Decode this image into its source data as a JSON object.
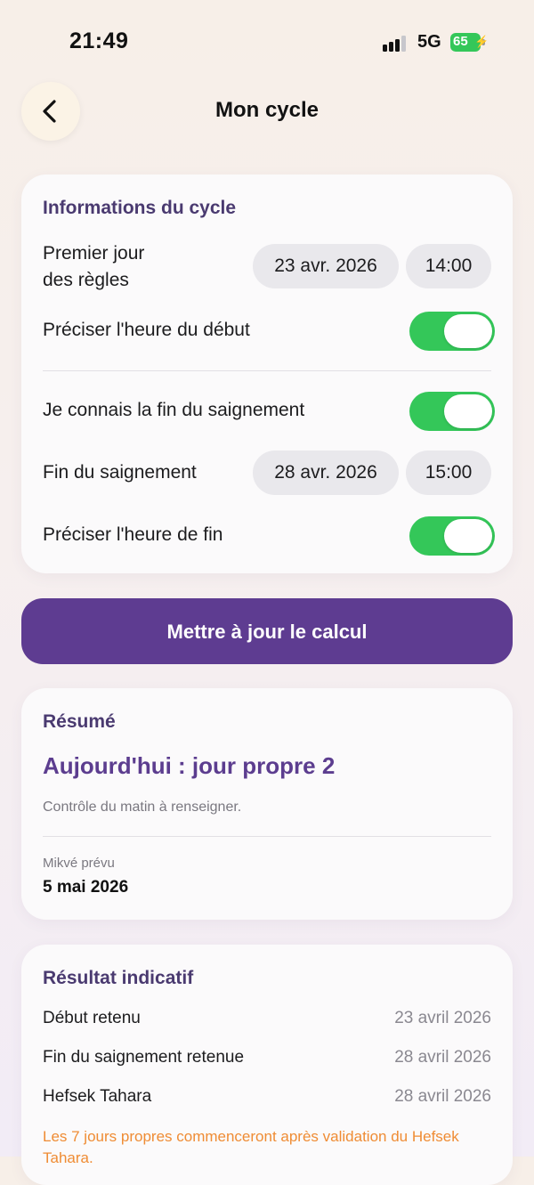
{
  "status_bar": {
    "time": "21:49",
    "network": "5G",
    "battery": "65"
  },
  "header": {
    "title": "Mon cycle"
  },
  "cycle_info": {
    "title": "Informations du cycle",
    "first_day_label_line1": "Premier jour",
    "first_day_label_line2": "des règles",
    "first_day_date": "23 avr. 2026",
    "first_day_time": "14:00",
    "start_time_toggle_label": "Préciser l'heure du début",
    "start_time_toggle_on": true,
    "know_end_label": "Je connais la fin du saignement",
    "know_end_on": true,
    "end_label": "Fin du saignement",
    "end_date": "28 avr. 2026",
    "end_time": "15:00",
    "end_time_toggle_label": "Préciser l'heure de fin",
    "end_time_toggle_on": true
  },
  "update_button": {
    "label": "Mettre à jour le calcul"
  },
  "summary": {
    "title": "Résumé",
    "status": "Aujourd'hui : jour propre 2",
    "note": "Contrôle du matin à renseigner.",
    "mikve_label": "Mikvé prévu",
    "mikve_date": "5 mai 2026"
  },
  "result": {
    "title": "Résultat indicatif",
    "rows": [
      {
        "label": "Début retenu",
        "value": "23 avril 2026"
      },
      {
        "label": "Fin du saignement retenue",
        "value": "28 avril 2026"
      },
      {
        "label": "Hefsek Tahara",
        "value": "28 avril 2026"
      }
    ],
    "warning": "Les 7 jours propres commenceront après validation du Hefsek Tahara."
  },
  "colors": {
    "accent": "#5e3c91",
    "toggle_on": "#34c759",
    "warning": "#ef8c34"
  }
}
